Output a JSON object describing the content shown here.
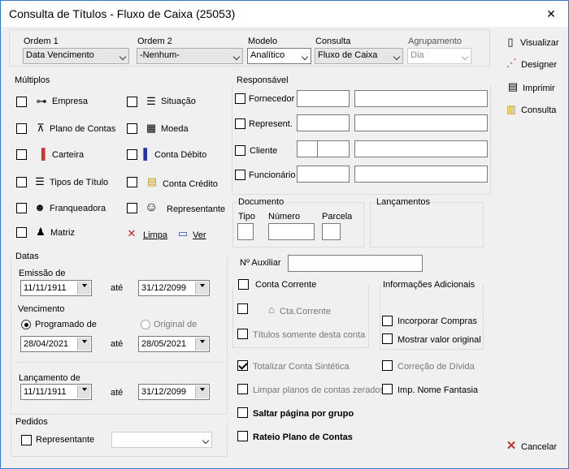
{
  "window": {
    "title": "Consulta de Títulos - Fluxo de Caixa (25053)",
    "close": "✕"
  },
  "top": {
    "ordem1": {
      "label": "Ordem 1",
      "value": "Data Vencimento"
    },
    "ordem2": {
      "label": "Ordem 2",
      "value": "-Nenhum-"
    },
    "modelo": {
      "label": "Modelo",
      "value": "Analítico"
    },
    "consulta": {
      "label": "Consulta",
      "value": "Fluxo de Caixa"
    },
    "agrupamento": {
      "label": "Agrupamento",
      "value": "Dia"
    }
  },
  "multiplos": {
    "label": "Múltiplos",
    "items": {
      "empresa": "Empresa",
      "situacao": "Situação",
      "plano": "Plano de Contas",
      "moeda": "Moeda",
      "carteira": "Carteira",
      "conta_debito": "Conta Débito",
      "tipos": "Tipos de Título",
      "conta_credito": "Conta Crédito",
      "franqueadora": "Franqueadora",
      "representante": "Representante",
      "matriz": "Matriz",
      "limpa": "Limpa",
      "ver": "Ver"
    }
  },
  "responsavel": {
    "label": "Responsável",
    "fornecedor": "Fornecedor",
    "represent": "Represent.",
    "cliente": "Cliente",
    "funcionario": "Funcionário"
  },
  "documento": {
    "label": "Documento",
    "tipo": "Tipo",
    "numero": "Número",
    "parcela": "Parcela"
  },
  "lancamentos": {
    "label": "Lançamentos"
  },
  "datas": {
    "label": "Datas",
    "emissao": "Emissão de",
    "emissao_de": "11/11/1911",
    "emissao_ate": "31/12/2099",
    "ate": "até",
    "vencimento": "Vencimento",
    "programado": "Programado de",
    "original": "Original de",
    "venc_de": "28/04/2021",
    "venc_ate": "28/05/2021",
    "lancamento": "Lançamento de",
    "lanc_de": "11/11/1911",
    "lanc_ate": "31/12/2099"
  },
  "pedidos": {
    "label": "Pedidos",
    "representante": "Representante"
  },
  "auxiliar": {
    "label": "Nº Auxiliar"
  },
  "conta_corrente": {
    "label": "Conta Corrente",
    "cta": "Cta.Corrente",
    "somente": "Títulos somente desta conta"
  },
  "info": {
    "label": "Informações Adicionais",
    "incorporar": "Incorporar Compras",
    "mostrar": "Mostrar valor original"
  },
  "options": {
    "totalizar": "Totalizar Conta Sintética",
    "correcao": "Correção de Dívida",
    "limpar": "Limpar planos de contas zerados",
    "imp_nome": "Imp. Nome Fantasia",
    "saltar": "Saltar página por grupo",
    "rateio": "Rateio Plano de Contas"
  },
  "buttons": {
    "visualizar": "Visualizar",
    "designer": "Designer",
    "imprimir": "Imprimir",
    "consulta": "Consulta",
    "cancelar": "Cancelar"
  },
  "colors": {
    "accent": "#3a78c9",
    "cancel": "#c0392b"
  }
}
